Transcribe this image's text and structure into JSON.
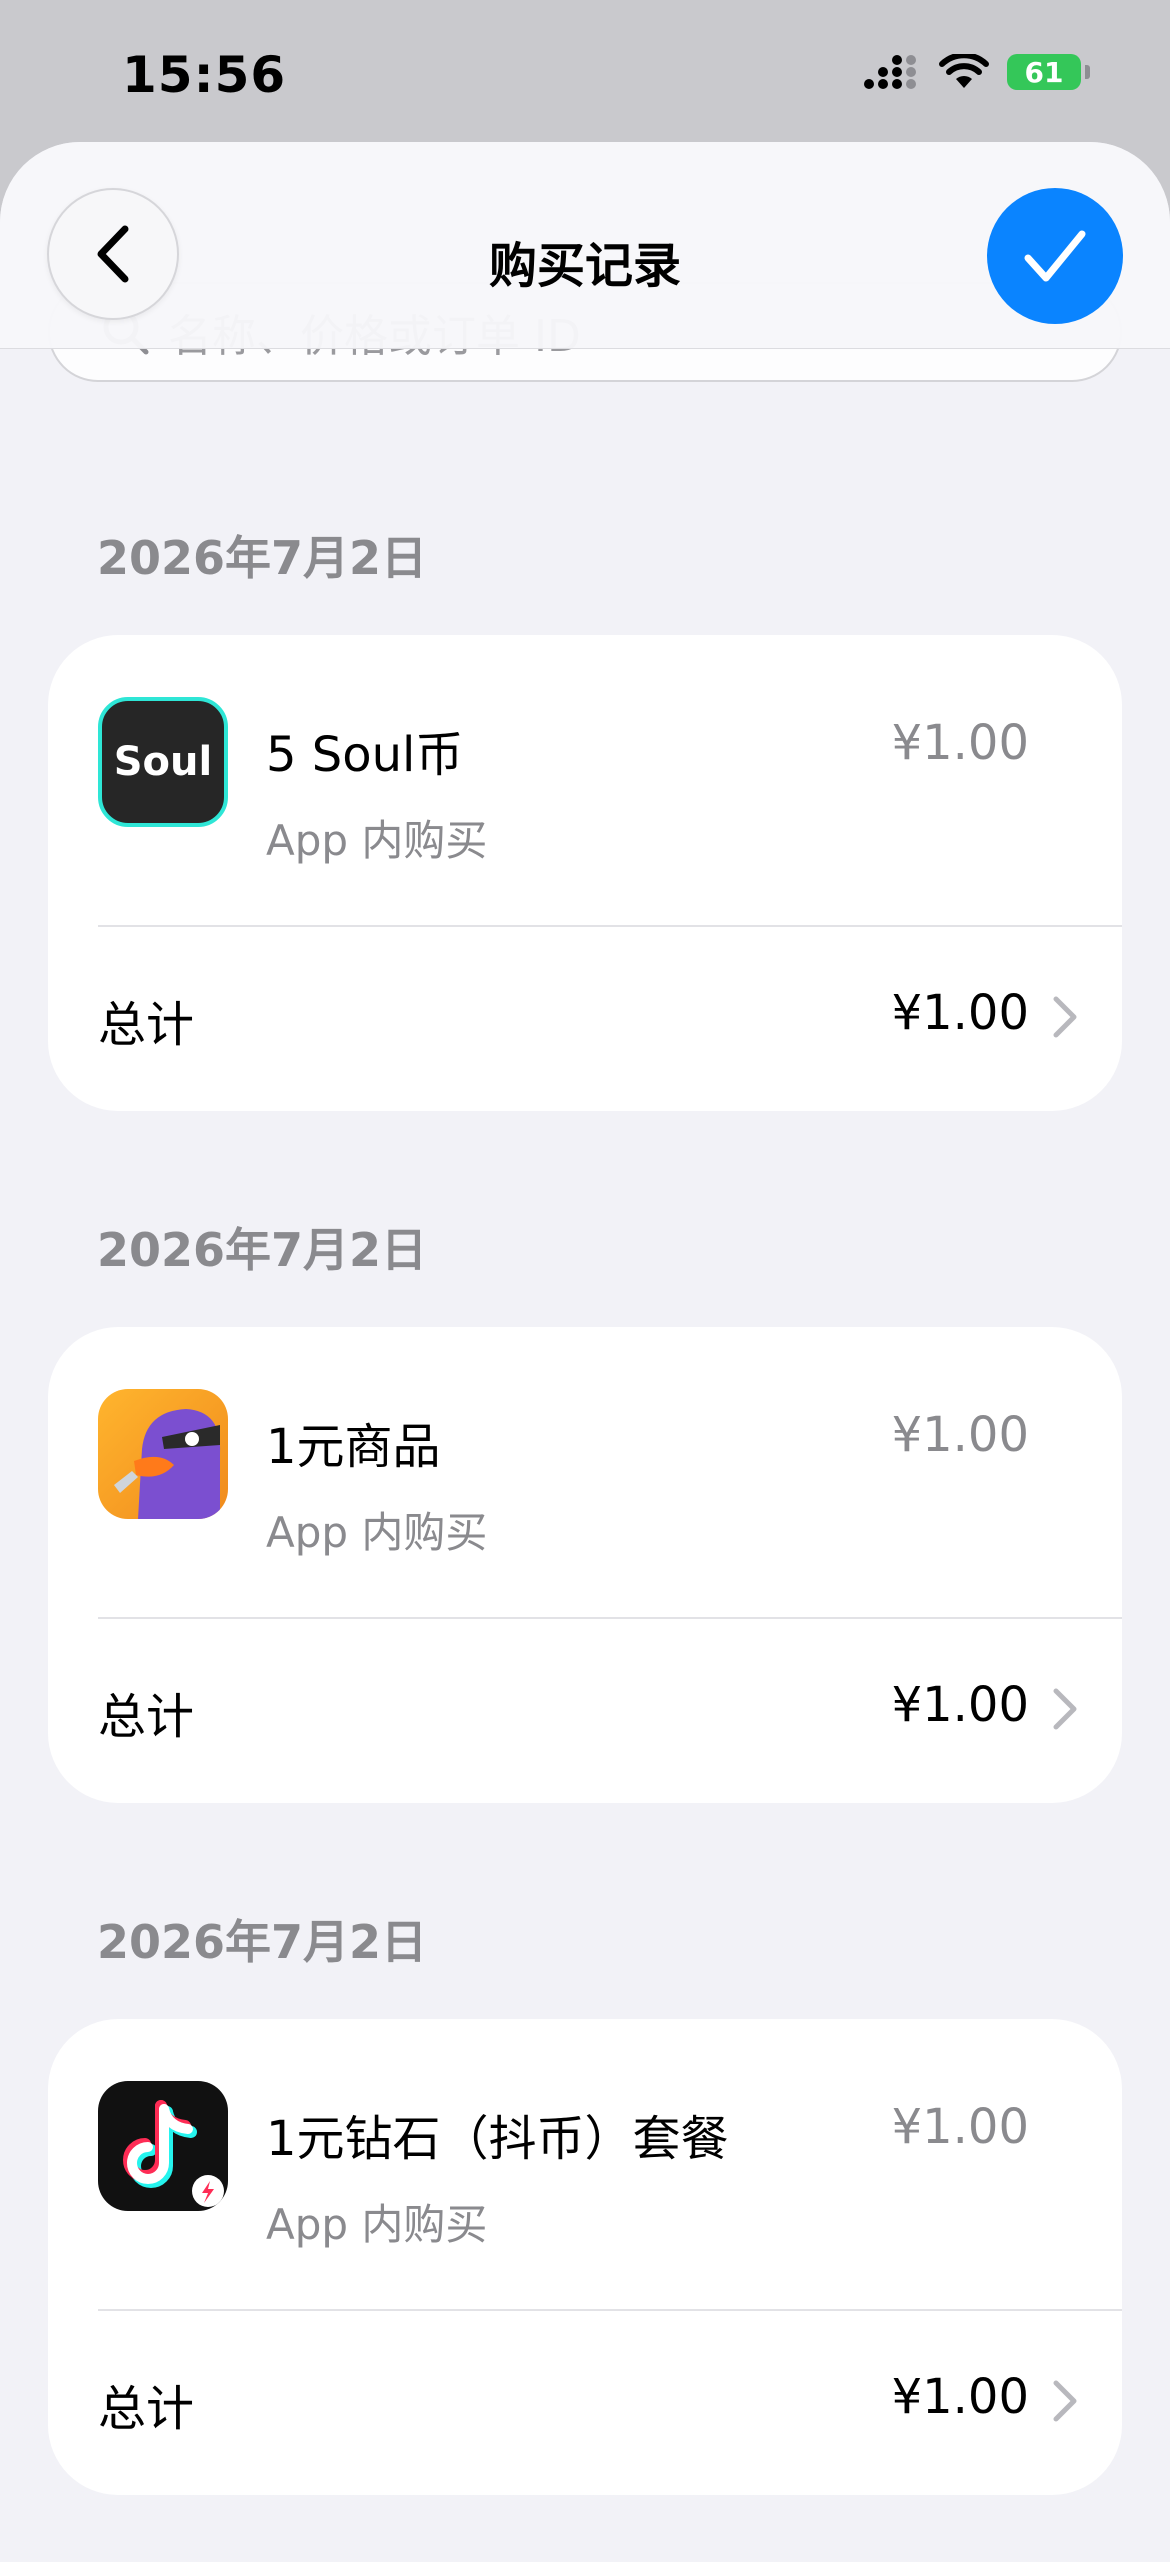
{
  "status_bar": {
    "time": "15:56",
    "battery": "61"
  },
  "nav": {
    "title": "购买记录"
  },
  "search": {
    "placeholder": "名称、价格或订单 ID"
  },
  "groups": [
    {
      "date": "2026年7月2日",
      "item_name": "5 Soul币",
      "item_price": "¥1.00",
      "item_type": "App 内购买",
      "icon_text": "Soul",
      "total_label": "总计",
      "total_value": "¥1.00"
    },
    {
      "date": "2026年7月2日",
      "item_name": "1元商品",
      "item_price": "¥1.00",
      "item_type": "App 内购买",
      "total_label": "总计",
      "total_value": "¥1.00"
    },
    {
      "date": "2026年7月2日",
      "item_name": "1元钻石（抖币）套餐",
      "item_price": "¥1.00",
      "item_type": "App 内购买",
      "total_label": "总计",
      "total_value": "¥1.00"
    }
  ],
  "colors": {
    "accent": "#0a84ff",
    "battery": "#34c759",
    "background": "#f2f2f7"
  },
  "icons": [
    "back-chevron-icon",
    "checkmark-icon",
    "search-icon",
    "chevron-right-icon",
    "wifi-icon",
    "signal-icon",
    "battery-icon"
  ]
}
